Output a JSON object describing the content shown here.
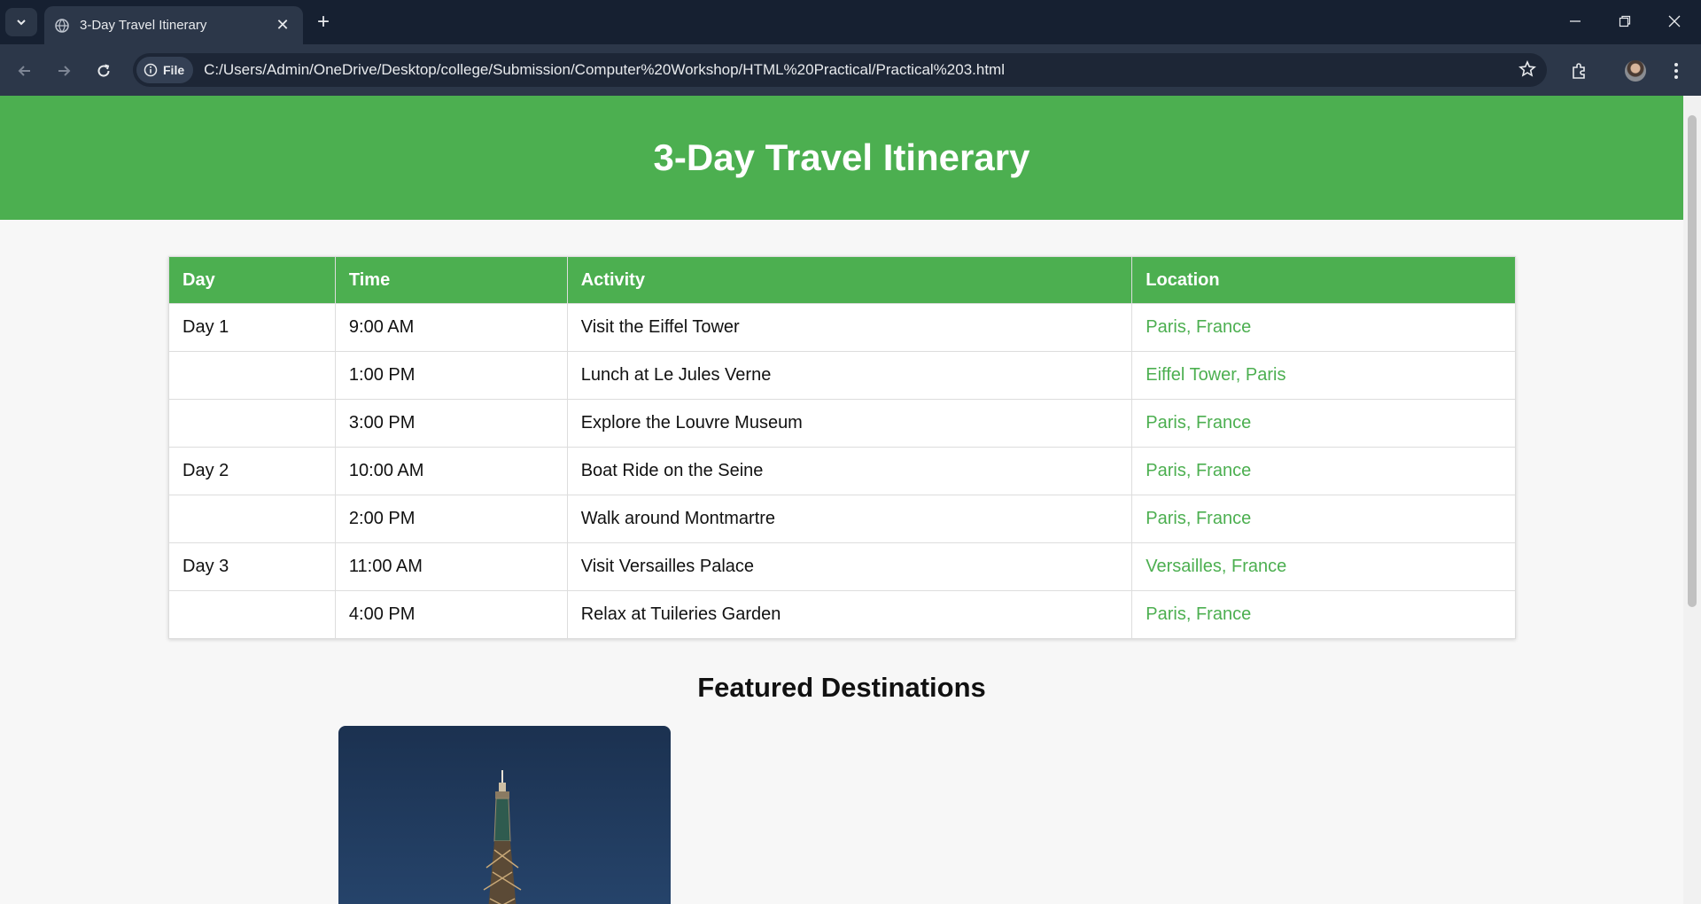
{
  "browser": {
    "tab_title": "3-Day Travel Itinerary",
    "site_chip": "File",
    "url": "C:/Users/Admin/OneDrive/Desktop/college/Submission/Computer%20Workshop/HTML%20Practical/Practical%203.html"
  },
  "page": {
    "heading": "3-Day Travel Itinerary",
    "table": {
      "headers": [
        "Day",
        "Time",
        "Activity",
        "Location"
      ],
      "rows": [
        {
          "day": "Day 1",
          "time": "9:00 AM",
          "activity": "Visit the Eiffel Tower",
          "location": "Paris, France"
        },
        {
          "day": "",
          "time": "1:00 PM",
          "activity": "Lunch at Le Jules Verne",
          "location": "Eiffel Tower, Paris"
        },
        {
          "day": "",
          "time": "3:00 PM",
          "activity": "Explore the Louvre Museum",
          "location": "Paris, France"
        },
        {
          "day": "Day 2",
          "time": "10:00 AM",
          "activity": "Boat Ride on the Seine",
          "location": "Paris, France"
        },
        {
          "day": "",
          "time": "2:00 PM",
          "activity": "Walk around Montmartre",
          "location": "Paris, France"
        },
        {
          "day": "Day 3",
          "time": "11:00 AM",
          "activity": "Visit Versailles Palace",
          "location": "Versailles, France"
        },
        {
          "day": "",
          "time": "4:00 PM",
          "activity": "Relax at Tuileries Garden",
          "location": "Paris, France"
        }
      ]
    },
    "featured_title": "Featured Destinations"
  },
  "colors": {
    "accent": "#4caf50",
    "tabstrip": "#162031",
    "toolbar": "#2c3749"
  },
  "icons": [
    "tab-search-icon",
    "globe-icon",
    "close-icon",
    "plus-icon",
    "minimize-icon",
    "restore-icon",
    "window-close-icon",
    "back-arrow-icon",
    "forward-arrow-icon",
    "reload-icon",
    "info-icon",
    "star-icon",
    "extensions-icon",
    "avatar",
    "menu-kebab-icon"
  ]
}
